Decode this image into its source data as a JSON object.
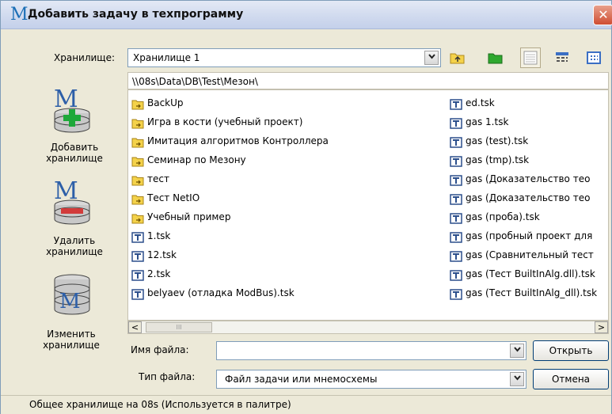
{
  "window": {
    "title_logo": "M",
    "title": "Добавить задачу в техпрограмму",
    "close_glyph": "✕"
  },
  "toolbar": {
    "storage_label": "Хранилище:",
    "storage_value": "Хранилище 1",
    "icons": [
      "folder-up-icon",
      "new-folder-icon",
      "list-view-icon",
      "details-view-icon",
      "thumbnails-view-icon"
    ]
  },
  "path": "\\\\08s\\Data\\DB\\Test\\Мезон\\",
  "sidebar": {
    "items": [
      {
        "label1": "Добавить",
        "label2": "хранилище",
        "icon": "add-storage-icon"
      },
      {
        "label1": "Удалить",
        "label2": "хранилище",
        "icon": "remove-storage-icon"
      },
      {
        "label1": "Изменить",
        "label2": "хранилище",
        "icon": "edit-storage-icon"
      }
    ]
  },
  "files": {
    "col1": [
      {
        "name": "BackUp",
        "type": "folder"
      },
      {
        "name": "Игра в кости (учебный проект)",
        "type": "folder"
      },
      {
        "name": "Имитация алгоритмов Контроллера",
        "type": "folder"
      },
      {
        "name": "Семинар по Мезону",
        "type": "folder"
      },
      {
        "name": "тест",
        "type": "folder"
      },
      {
        "name": "Тест NetIO",
        "type": "folder"
      },
      {
        "name": "Учебный пример",
        "type": "folder"
      },
      {
        "name": "1.tsk",
        "type": "task"
      },
      {
        "name": "12.tsk",
        "type": "task"
      },
      {
        "name": "2.tsk",
        "type": "task"
      },
      {
        "name": "belyaev (отладка ModBus).tsk",
        "type": "task"
      }
    ],
    "col2": [
      {
        "name": "ed.tsk",
        "type": "task"
      },
      {
        "name": "gas 1.tsk",
        "type": "task"
      },
      {
        "name": "gas (test).tsk",
        "type": "task"
      },
      {
        "name": "gas (tmp).tsk",
        "type": "task"
      },
      {
        "name": "gas (Доказательство тео",
        "type": "task"
      },
      {
        "name": "gas (Доказательство тео",
        "type": "task"
      },
      {
        "name": "gas (проба).tsk",
        "type": "task"
      },
      {
        "name": "gas (пробный проект для",
        "type": "task"
      },
      {
        "name": "gas (Сравнительный тест",
        "type": "task"
      },
      {
        "name": "gas (Тест BuiltInAlg.dll).tsk",
        "type": "task"
      },
      {
        "name": "gas (Тест BuiltInAlg_dll).tsk",
        "type": "task"
      }
    ]
  },
  "scroll": {
    "left": "<",
    "right": ">",
    "thumb": "III"
  },
  "bottom": {
    "filename_label": "Имя файла:",
    "filename_value": "",
    "filetype_label": "Тип файла:",
    "filetype_value": "Файл задачи или мнемосхемы",
    "open_label": "Открыть",
    "cancel_label": "Отмена",
    "dropdown_glyph": "▼"
  },
  "status": "Общее хранилище на 08s (Используется в палитре)",
  "colors": {
    "folder": "#f4d24a",
    "task": "#2c4f8c",
    "accent": "#1c6fb6",
    "plus": "#1ea83a",
    "minus": "#d23b3b"
  }
}
